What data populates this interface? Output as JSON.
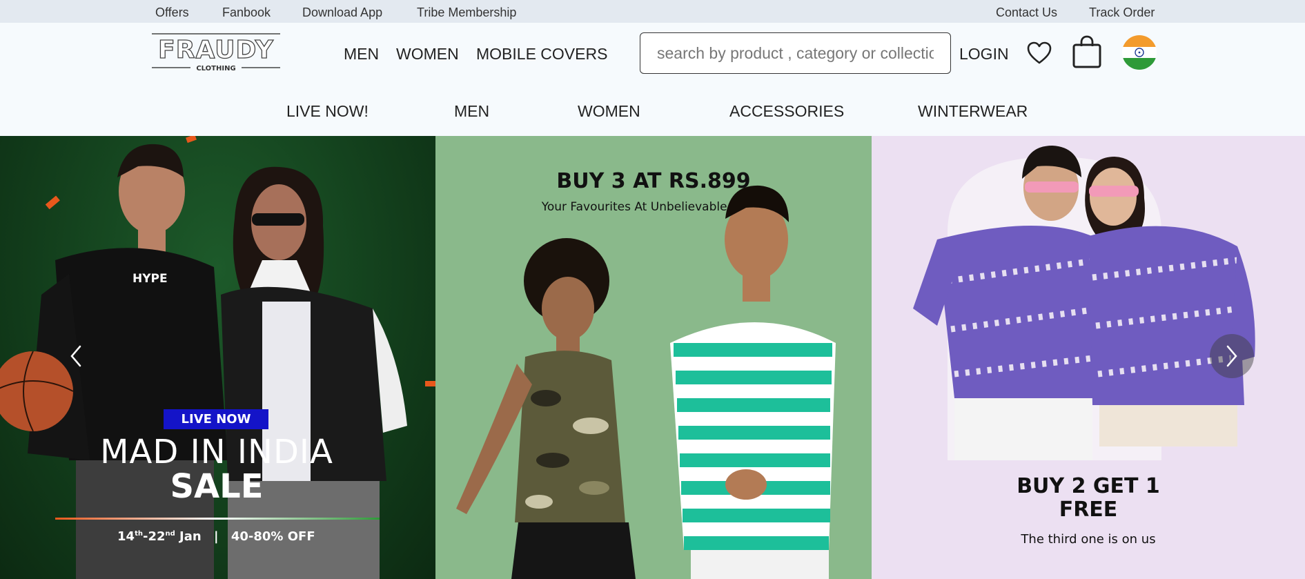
{
  "top_links": {
    "offers": "Offers",
    "fanbook": "Fanbook",
    "download_app": "Download App",
    "tribe": "Tribe Membership",
    "contact": "Contact Us",
    "track": "Track Order"
  },
  "brand": {
    "name": "FRAUDY",
    "tagline": "CLOTHING"
  },
  "main_nav": {
    "men": "MEN",
    "women": "WOMEN",
    "mobile_covers": "MOBILE COVERS"
  },
  "search": {
    "placeholder": "search by product , category or collection",
    "value": ""
  },
  "login": "LOGIN",
  "icons": {
    "wishlist": "heart-icon",
    "cart": "shopping-bag-icon",
    "country": "india-flag-icon",
    "prev": "chevron-left-icon",
    "next": "chevron-right-icon"
  },
  "sub_nav": {
    "live": "LIVE NOW!",
    "men": "MEN",
    "women": "WOMEN",
    "accessories": "ACCESSORIES",
    "winterwear": "WINTERWEAR"
  },
  "banners": {
    "sale": {
      "badge": "LIVE NOW",
      "title_line1": "MAD IN INDIA",
      "title_line2": "SALE",
      "date_start": "14",
      "date_start_sup": "th",
      "date_sep": "-22",
      "date_end_sup": "nd",
      "month": " Jan",
      "divider": "|",
      "discount": "40-80% OFF"
    },
    "buy3": {
      "title": "BUY 3 AT RS.899",
      "subtitle": "Your Favourites At Unbelievable Prices"
    },
    "buy2": {
      "title_line1": "BUY 2 GET 1",
      "title_line2": "FREE",
      "subtitle": "The third one is on us"
    }
  },
  "colors": {
    "topstrip": "#e3e9f0",
    "header_bg": "#f6fafd",
    "sale_bg": "#123d1b",
    "buy3_bg": "#8ab98b",
    "buy2_bg": "#ece0f2",
    "badge_bg": "#1414c8"
  }
}
